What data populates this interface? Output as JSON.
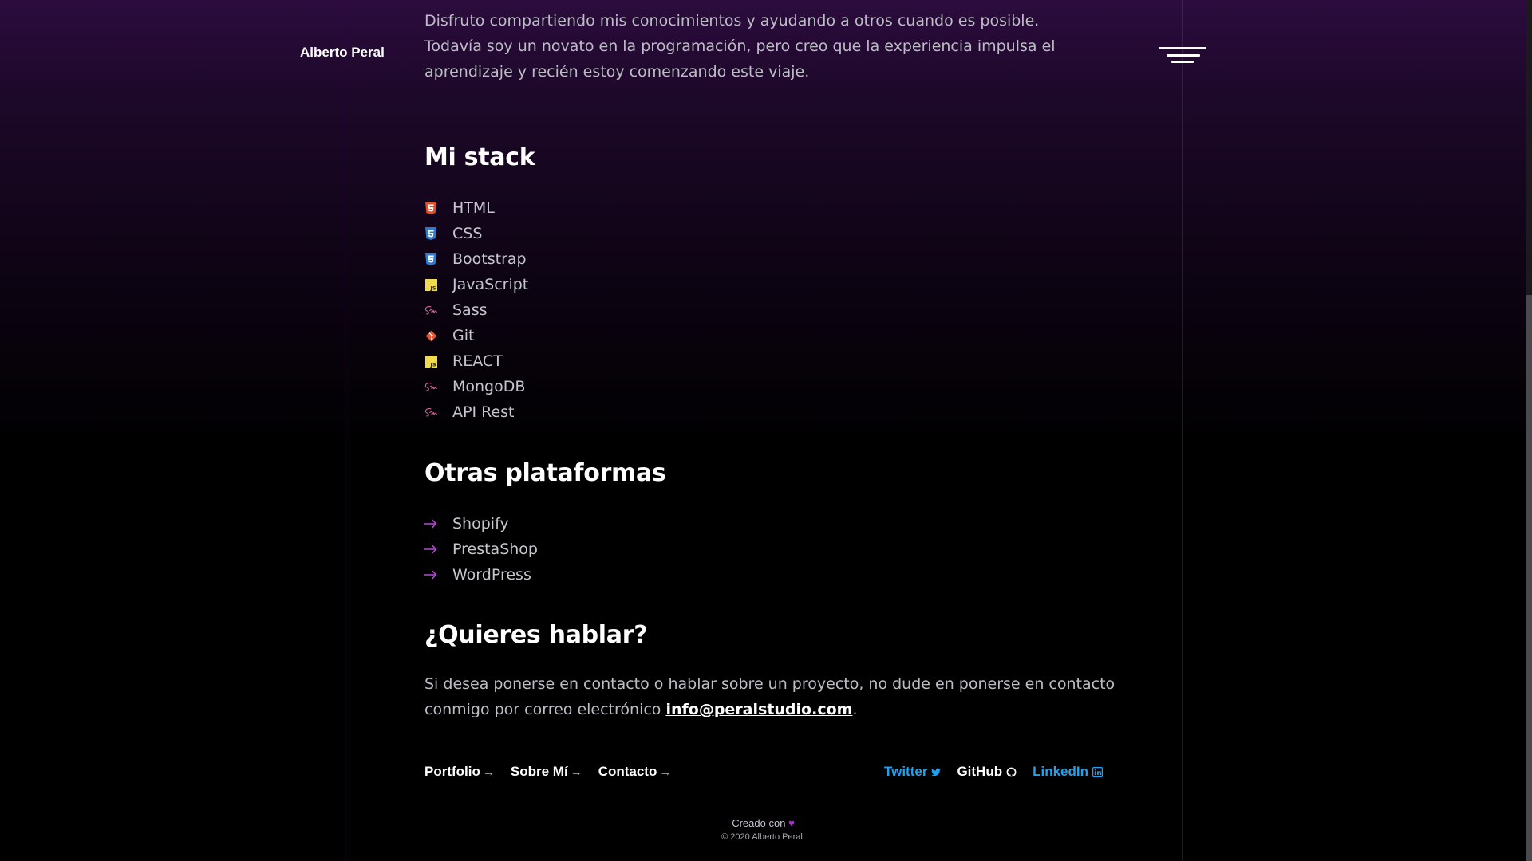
{
  "header": {
    "brand": "Alberto Peral",
    "menu_icon": "hamburger-icon"
  },
  "intro": {
    "text": "Disfruto compartiendo mis conocimientos y ayudando a otros cuando es posible. Todavía soy un novato en la programación, pero creo que la experiencia impulsa el aprendizaje y recién estoy comenzando este viaje."
  },
  "stack": {
    "title": "Mi stack",
    "items": [
      {
        "label": "HTML",
        "icon": "html5-icon",
        "color": "#e44d26"
      },
      {
        "label": "CSS",
        "icon": "css3-icon",
        "color": "#2a7ad6"
      },
      {
        "label": "Bootstrap",
        "icon": "css3-icon",
        "color": "#2a7ad6"
      },
      {
        "label": "JavaScript",
        "icon": "js-icon",
        "color": "#f0db4f"
      },
      {
        "label": "Sass",
        "icon": "sass-icon",
        "color": "#cd6799"
      },
      {
        "label": "Git",
        "icon": "git-icon",
        "color": "#f05032"
      },
      {
        "label": "REACT",
        "icon": "js-icon",
        "color": "#f0db4f"
      },
      {
        "label": "MongoDB",
        "icon": "sass-icon",
        "color": "#cd6799"
      },
      {
        "label": "API Rest",
        "icon": "sass-icon",
        "color": "#cd6799"
      }
    ]
  },
  "platforms": {
    "title": "Otras plataformas",
    "arrow_color": "#b64ad8",
    "items": [
      {
        "label": "Shopify",
        "icon": "arrow-right-icon"
      },
      {
        "label": "PrestaShop",
        "icon": "arrow-right-icon"
      },
      {
        "label": "WordPress",
        "icon": "arrow-right-icon"
      }
    ]
  },
  "contact": {
    "title": "¿Quieres hablar?",
    "text_before": "Si desea ponerse en contacto o hablar sobre un proyecto, no dude en ponerse en contacto conmigo por correo electrónico ",
    "email": "info@peralstudio.com",
    "text_after": "."
  },
  "footer": {
    "nav": [
      {
        "label": "Portfolio",
        "arrow": "→"
      },
      {
        "label": "Sobre Mí",
        "arrow": "→"
      },
      {
        "label": "Contacto",
        "arrow": "→"
      }
    ],
    "social": [
      {
        "label": "Twitter",
        "icon": "twitter-icon",
        "color": "#1da1f2"
      },
      {
        "label": "GitHub",
        "icon": "github-icon",
        "color": "#ffffff"
      },
      {
        "label": "LinkedIn",
        "icon": "linkedin-icon",
        "color": "#1da1f2"
      }
    ],
    "made_with": "Creado con",
    "heart_icon": "heart-icon",
    "heart": "♥",
    "copyright": "© 2020 Alberto Peral."
  }
}
